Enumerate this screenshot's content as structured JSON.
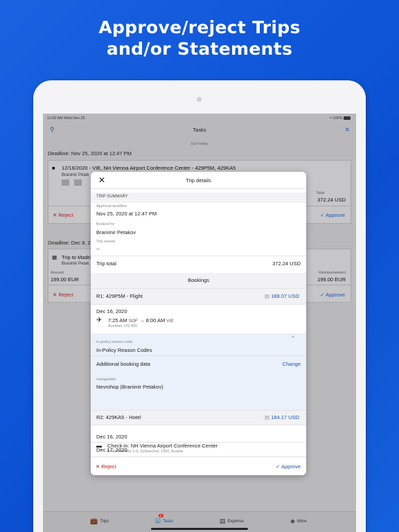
{
  "headline": [
    "Approve/reject Trips",
    "and/or Statements"
  ],
  "status": {
    "time": "11:00 AM  Wed Nov 25",
    "battery": "100%"
  },
  "nav": {
    "title": "Tasks"
  },
  "list": {
    "due_label": "Due today",
    "deadline1": "Deadline: Nov 25, 2020 at 12:47 PM",
    "card1": {
      "title": "12/16/2020 - VIE, NH Vienna Airport Conference Center - 429P5M, 429KA5",
      "traveler": "Branimir Petak",
      "total_label": "Total",
      "total": "372.24 USD",
      "reject": "Reject",
      "approve": "Approve"
    },
    "deadline2": "Deadline: Dec 8, 2",
    "card2": {
      "title": "Trip to Madri",
      "traveler": "Branimir Petak",
      "amount_label": "Amount",
      "amount": "199.00 EUR",
      "reimb_label": "Reimbursement",
      "reimb": "199.00 EUR",
      "reject": "Reject",
      "approve": "Approve"
    }
  },
  "tabs": [
    {
      "label": "Trips",
      "icon": "briefcase-icon"
    },
    {
      "label": "Tasks",
      "icon": "checkbox-icon",
      "badge": "2"
    },
    {
      "label": "Expense",
      "icon": "receipt-icon"
    },
    {
      "label": "More",
      "icon": "layers-icon"
    }
  ],
  "modal": {
    "title": "Trip details",
    "trip_summary": "TRIP SUMMARY",
    "approval_deadline_label": "Approval deadline",
    "approval_deadline": "Nov 25, 2020 at 12:47 PM",
    "booked_for_label": "Booked for",
    "booked_for": "Branimir Petakov",
    "trip_reason_label": "Trip reason",
    "trip_reason": "--",
    "trip_total_label": "Trip total",
    "trip_total": "372.24 USD",
    "bookings_label": "Bookings",
    "r1": {
      "title": "R1: 429P5M - Flight",
      "price": "188.07 USD"
    },
    "flight": {
      "date": "Dec 16, 2020",
      "dep_time": "7:25 AM",
      "dep_code": "SOF",
      "arr_time": "8:00 AM",
      "arr_code": "VIE",
      "carrier": "Austrian, OS 800"
    },
    "policy_label": "In-policy reason code",
    "policy_value": "In-Policy Reason Codes",
    "additional_label": "Additional booking data",
    "change_label": "Change",
    "changeable_label": "changeable",
    "changeable_value": "Nevrohop (Branimir Petakov)",
    "r2": {
      "title": "R2: 429KA5 - Hotel",
      "price": "184.17 USD"
    },
    "hotel": {
      "date": "Dec 16, 2020",
      "checkin_label": "Check-in:",
      "name": "NH Vienna Airport Conference Center",
      "address": "Einfahrtstraße 1-3, Schwechat, 1300, Austria"
    },
    "date3": "Dec 17, 2020",
    "reject": "Reject",
    "approve": "Approve"
  },
  "colors": {
    "accent": "#1b55b0",
    "reject": "#b01c1c",
    "background": "#0e56d8"
  }
}
